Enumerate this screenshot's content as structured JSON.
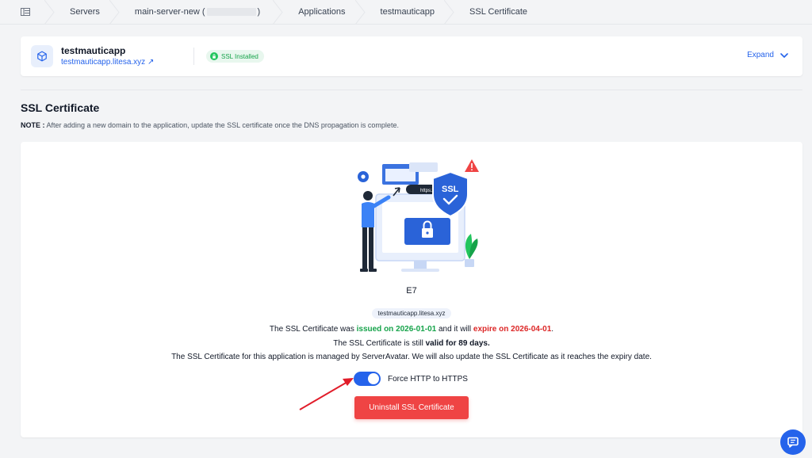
{
  "breadcrumb": {
    "items": [
      "Servers",
      "main-server-new (",
      ")",
      "Applications",
      "testmauticapp",
      "SSL Certificate"
    ]
  },
  "app": {
    "name": "testmauticapp",
    "domain": "testmauticapp.litesa.xyz",
    "ssl_badge": "SSL Installed",
    "expand_label": "Expand"
  },
  "section": {
    "title": "SSL Certificate",
    "note_label": "NOTE :",
    "note_text": " After adding a new domain to the application, update the SSL certificate once the DNS propagation is complete."
  },
  "certificate": {
    "illustration_text": {
      "url": "https://",
      "ssl": "SSL"
    },
    "issuer": "E7",
    "domain": "testmauticapp.litesa.xyz",
    "line1_a": "The SSL Certificate was ",
    "issued": "issued on 2026-01-01",
    "line1_b": " and it will ",
    "expire": "expire on 2026-04-01",
    "line1_c": ".",
    "line2_a": "The SSL Certificate is still ",
    "valid": "valid for 89 days.",
    "line3": "The SSL Certificate for this application is managed by ServerAvatar. We will also update the SSL Certificate as it reaches the expiry date.",
    "force_https_label": "Force HTTP to HTTPS",
    "force_https_enabled": true,
    "uninstall_label": "Uninstall SSL Certificate"
  },
  "colors": {
    "accent": "#2563eb",
    "success": "#16a34a",
    "danger": "#ef4444"
  }
}
